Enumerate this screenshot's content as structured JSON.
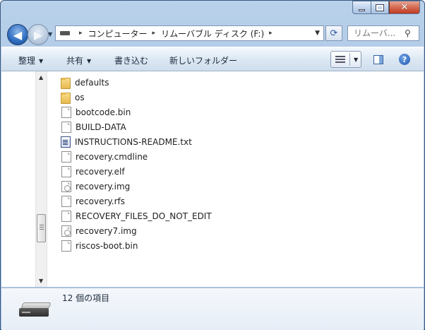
{
  "window": {
    "minimize_icon": "minimize-icon",
    "maximize_icon": "maximize-icon",
    "close_glyph": "✕"
  },
  "nav": {
    "back_glyph": "◀",
    "forward_glyph": "▶",
    "history_glyph": "▼",
    "refresh_glyph": "⟳"
  },
  "address": {
    "separator": "▸",
    "crumbs": [
      "コンピューター",
      "リムーバブル ディスク (F:)"
    ],
    "drop_glyph": "▼"
  },
  "search": {
    "placeholder": "リムーバ...",
    "icon_glyph": "⚲"
  },
  "toolbar": {
    "organize": "整理",
    "share": "共有",
    "burn": "書き込む",
    "new_folder": "新しいフォルダー",
    "dropdown_glyph": "▼",
    "help_glyph": "?"
  },
  "scrollbar": {
    "up_glyph": "▲",
    "down_glyph": "▼"
  },
  "files": [
    {
      "name": "defaults",
      "type": "folder"
    },
    {
      "name": "os",
      "type": "folder"
    },
    {
      "name": "bootcode.bin",
      "type": "file"
    },
    {
      "name": "BUILD-DATA",
      "type": "file"
    },
    {
      "name": "INSTRUCTIONS-README.txt",
      "type": "text"
    },
    {
      "name": "recovery.cmdline",
      "type": "file"
    },
    {
      "name": "recovery.elf",
      "type": "file"
    },
    {
      "name": "recovery.img",
      "type": "image"
    },
    {
      "name": "recovery.rfs",
      "type": "file"
    },
    {
      "name": "RECOVERY_FILES_DO_NOT_EDIT",
      "type": "file"
    },
    {
      "name": "recovery7.img",
      "type": "image"
    },
    {
      "name": "riscos-boot.bin",
      "type": "file"
    }
  ],
  "details": {
    "item_count": "12 個の項目"
  },
  "colors": {
    "frame": "#a9c4e3",
    "close": "#c13a22",
    "folder": "#e8b94e"
  }
}
